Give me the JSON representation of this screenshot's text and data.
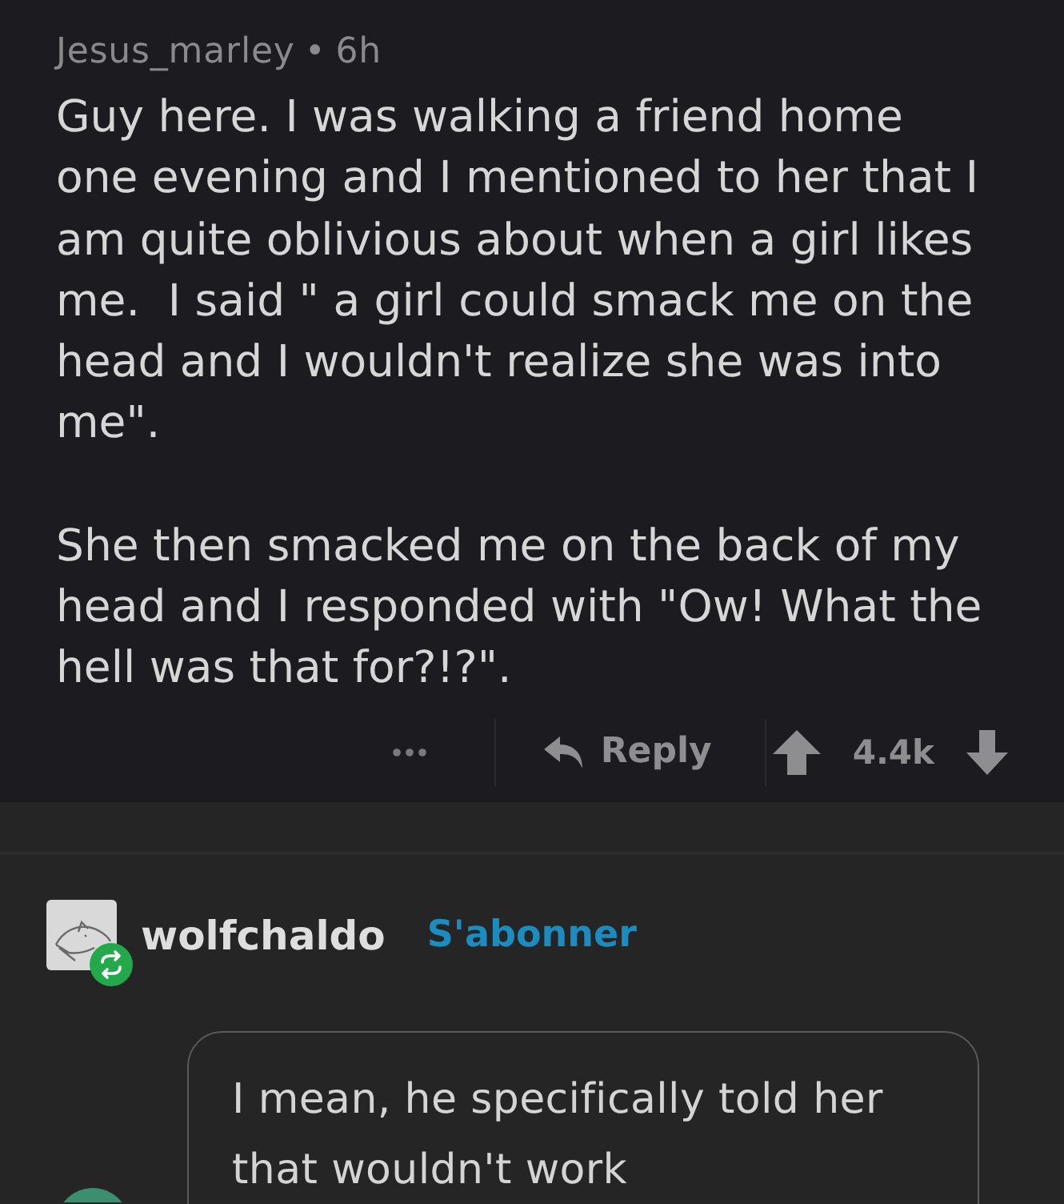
{
  "post": {
    "author": "Jesus_marley",
    "separator": "•",
    "age": "6h",
    "paragraphs": [
      "Guy here. I was walking a friend home one evening and I mentioned to her that I am quite oblivious about when a girl likes me.  I said \" a girl could smack me on the head and I wouldn't realize she was into me\".",
      "She then smacked me on the back of my head and I responded with \"Ow! What the hell was that for?!?\"."
    ],
    "reply_label": "Reply",
    "score": "4.4k"
  },
  "response": {
    "author": "wolfchaldo",
    "follow_label": "S'abonner",
    "message": "I mean, he specifically told her that wouldn't work"
  }
}
